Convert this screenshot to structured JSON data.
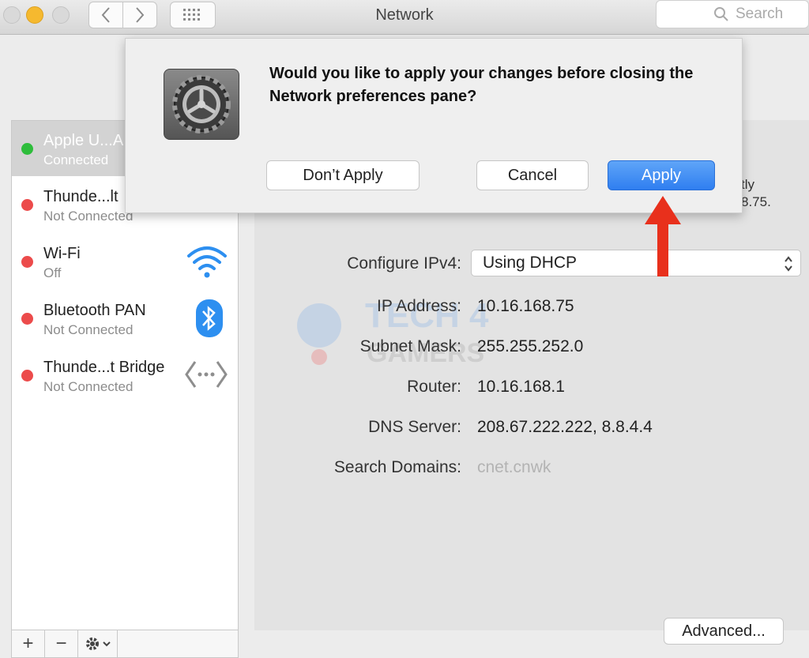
{
  "window": {
    "title": "Network",
    "search_placeholder": "Search"
  },
  "sidebar": {
    "services": [
      {
        "name": "Apple U...A",
        "status": "Connected",
        "state_color": "#2ebd3b",
        "selected": true
      },
      {
        "name": "Thunde...lt",
        "status": "Not Connected",
        "state_color": "#ec4b4b",
        "icon": "ethernet-arrows-icon"
      },
      {
        "name": "Wi-Fi",
        "status": "Off",
        "state_color": "#ec4b4b",
        "icon": "wifi-icon"
      },
      {
        "name": "Bluetooth PAN",
        "status": "Not Connected",
        "state_color": "#ec4b4b",
        "icon": "bluetooth-icon"
      },
      {
        "name": "Thunde...t Bridge",
        "status": "Not Connected",
        "state_color": "#ec4b4b",
        "icon": "ethernet-arrows-icon"
      }
    ],
    "toolbar": {
      "add_label": "+",
      "remove_label": "−"
    }
  },
  "detail": {
    "partial_right_1": "tly",
    "partial_right_2": "8.75.",
    "configure_ipv4_label": "Configure IPv4:",
    "configure_ipv4_value": "Using DHCP",
    "fields": [
      {
        "label": "IP Address:",
        "value": "10.16.168.75"
      },
      {
        "label": "Subnet Mask:",
        "value": "255.255.252.0"
      },
      {
        "label": "Router:",
        "value": "10.16.168.1"
      },
      {
        "label": "DNS Server:",
        "value": "208.67.222.222, 8.8.4.4"
      },
      {
        "label": "Search Domains:",
        "value": "cnet.cnwk"
      }
    ],
    "advanced_label": "Advanced..."
  },
  "dialog": {
    "message": "Would you like to apply your changes before closing the Network preferences pane?",
    "dont_apply_label": "Don’t Apply",
    "cancel_label": "Cancel",
    "apply_label": "Apply",
    "icon": "system-preferences-gear-icon"
  },
  "watermark": {
    "line1": "TECH 4",
    "line2": "GAMERS"
  },
  "colors": {
    "accent": "#2f7ef0",
    "annotation": "#e8301c",
    "connected": "#2ebd3b",
    "disconnected": "#ec4b4b"
  }
}
